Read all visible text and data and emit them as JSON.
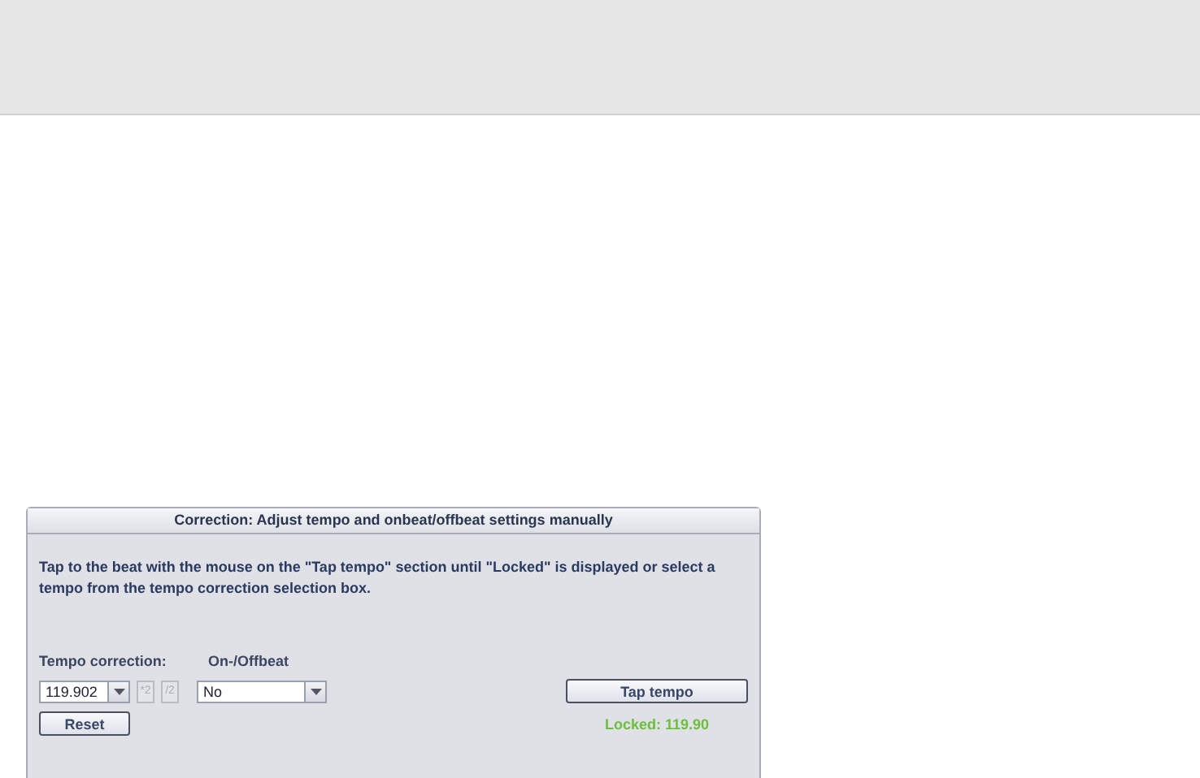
{
  "panel": {
    "title": "Correction: Adjust tempo and onbeat/offbeat settings manually",
    "instructions": "Tap to the beat with the mouse on the \"Tap tempo\" section until \"Locked\" is displayed or select a tempo from the tempo correction selection box.",
    "tempo_correction": {
      "label": "Tempo correction:",
      "value": "119.902",
      "buttons": [
        {
          "label": "*2",
          "disabled": true
        },
        {
          "label": "/2",
          "disabled": true
        }
      ]
    },
    "offbeat": {
      "label": "On-/Offbeat",
      "value": "No"
    },
    "reset_button": "Reset",
    "tap_button": "Tap tempo",
    "status": {
      "text": "Locked: 119.90",
      "locked": true
    }
  }
}
